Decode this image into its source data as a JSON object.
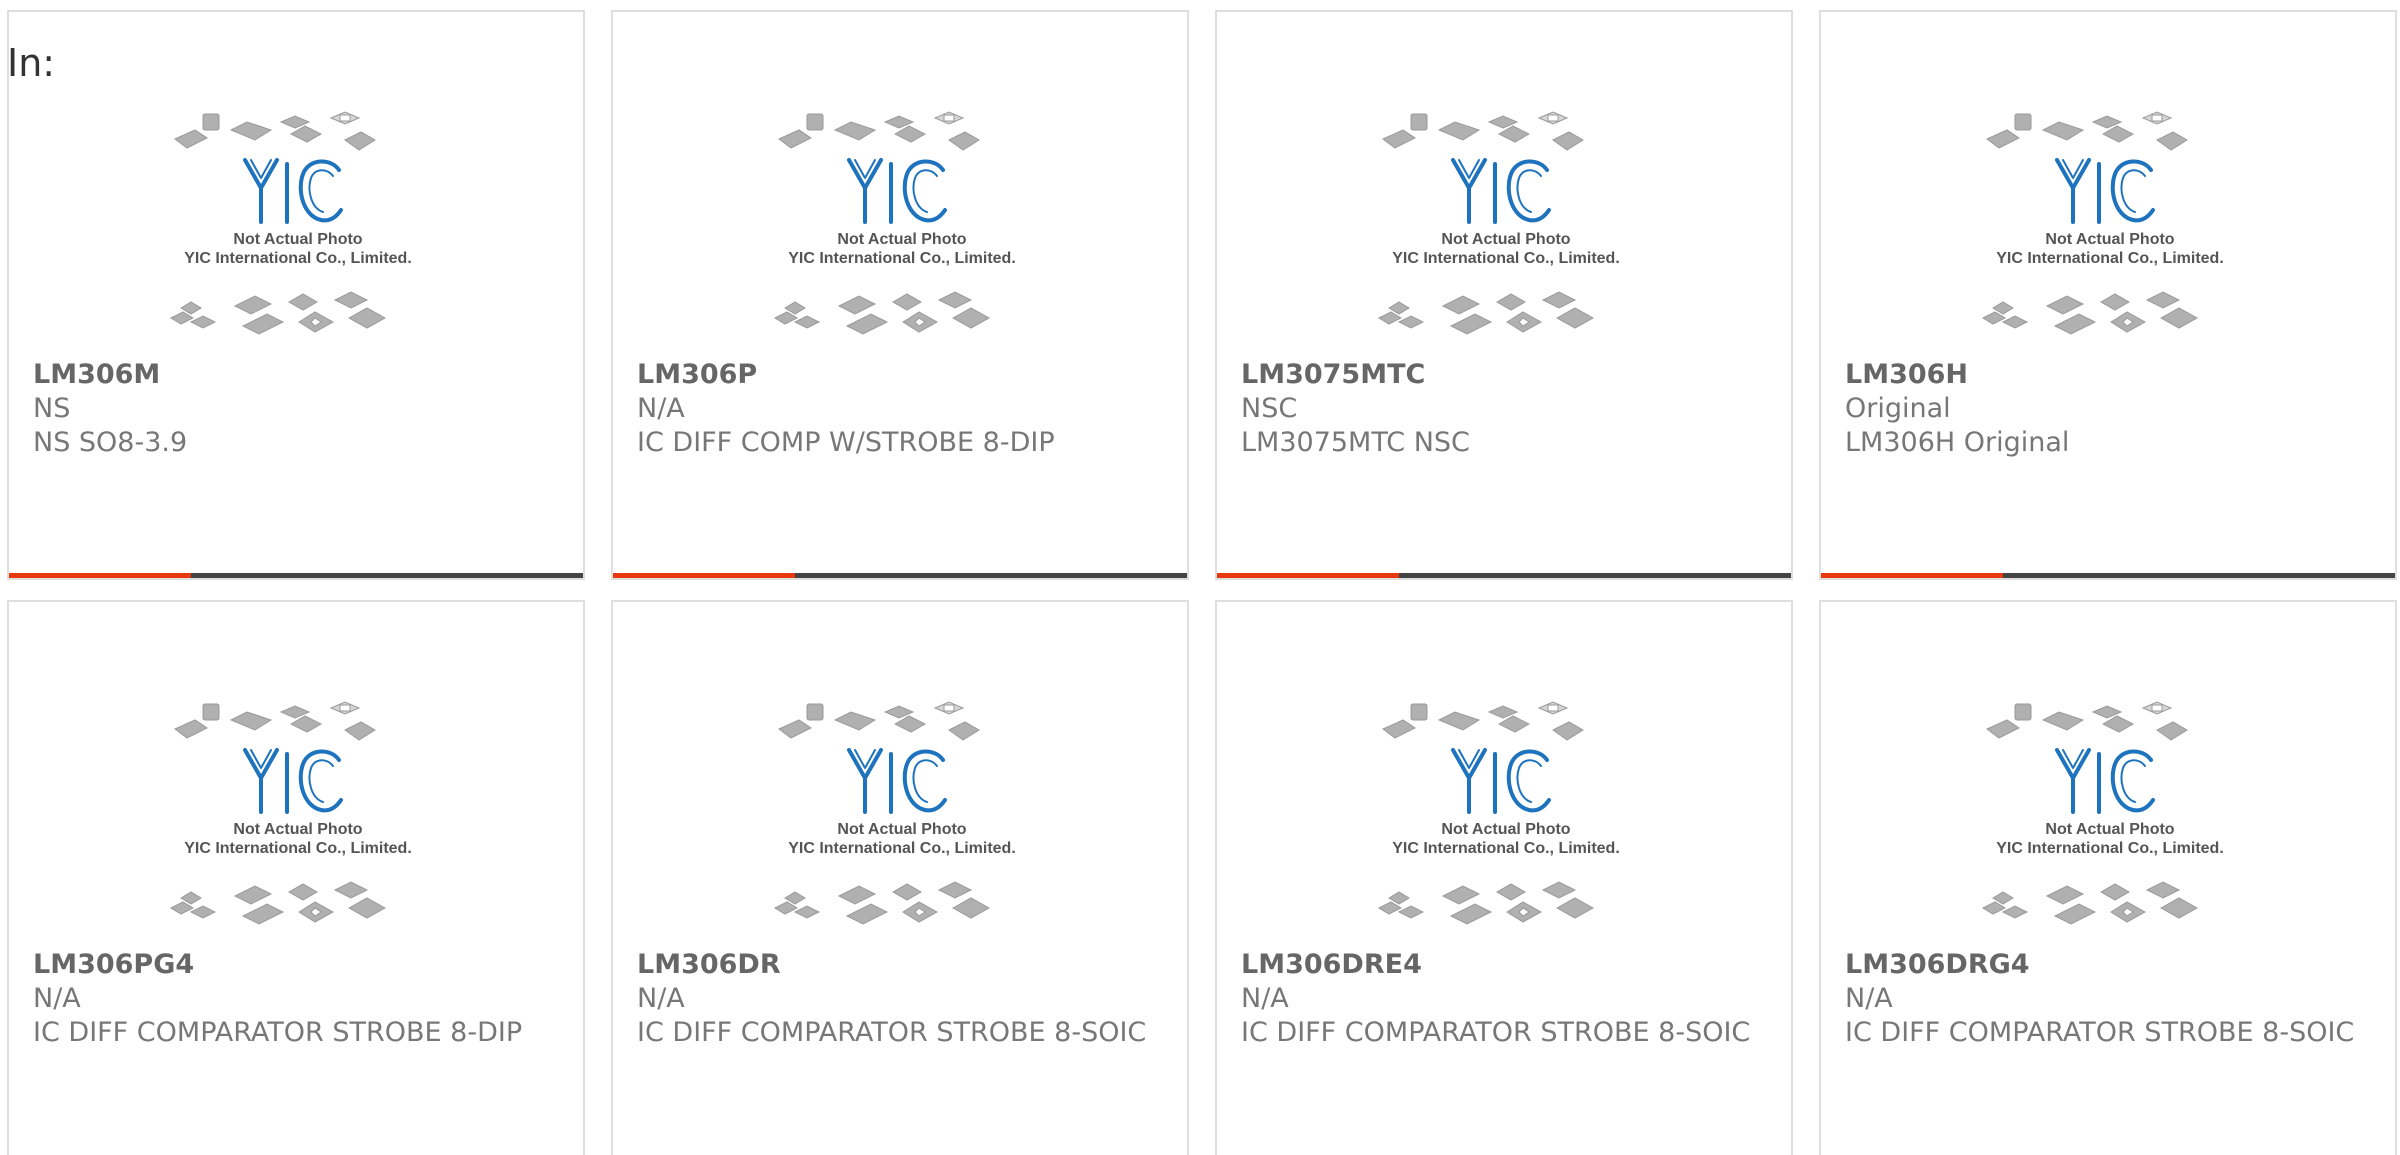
{
  "heading": "In:",
  "colors": {
    "accent": "#e8380d",
    "bar": "#444444",
    "logo": "#1e73be",
    "border": "#dedede"
  },
  "photo": {
    "logo_text": "YIC",
    "caption_line1": "Not Actual Photo",
    "caption_line2": "YIC International Co., Limited."
  },
  "cards": [
    {
      "part": "LM306M",
      "manufacturer": "NS",
      "description": "NS SO8-3.9"
    },
    {
      "part": "LM306P",
      "manufacturer": "N/A",
      "description": "IC DIFF COMP W/STROBE 8-DIP"
    },
    {
      "part": "LM3075MTC",
      "manufacturer": "NSC",
      "description": "LM3075MTC NSC"
    },
    {
      "part": "LM306H",
      "manufacturer": "Original",
      "description": "LM306H Original"
    },
    {
      "part": "LM306PG4",
      "manufacturer": "N/A",
      "description": "IC DIFF COMPARATOR STROBE 8-DIP"
    },
    {
      "part": "LM306DR",
      "manufacturer": "N/A",
      "description": "IC DIFF COMPARATOR STROBE 8-SOIC"
    },
    {
      "part": "LM306DRE4",
      "manufacturer": "N/A",
      "description": "IC DIFF COMPARATOR STROBE 8-SOIC"
    },
    {
      "part": "LM306DRG4",
      "manufacturer": "N/A",
      "description": "IC DIFF COMPARATOR STROBE 8-SOIC"
    }
  ]
}
